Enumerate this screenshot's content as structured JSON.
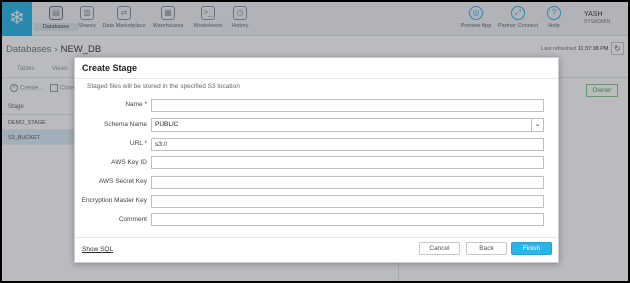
{
  "nav": {
    "logo_icon": "snowflake-icon",
    "items": [
      {
        "label": "Databases",
        "icon": "database-icon",
        "glyph": "▤"
      },
      {
        "label": "Shares",
        "icon": "share-icon",
        "glyph": "▥"
      },
      {
        "label": "Data Marketplace",
        "icon": "marketplace-icon",
        "glyph": "⇄"
      },
      {
        "label": "Warehouses",
        "icon": "warehouse-icon",
        "glyph": "▦"
      },
      {
        "label": "Worksheets",
        "icon": "worksheet-icon",
        "glyph": ">_"
      },
      {
        "label": "History",
        "icon": "history-icon",
        "glyph": "◷"
      }
    ],
    "right_items": [
      {
        "label": "Preview App",
        "icon": "preview-icon",
        "glyph": "◎"
      },
      {
        "label": "Partner Connect",
        "icon": "partner-connect-icon",
        "glyph": "⤢"
      },
      {
        "label": "Help",
        "icon": "help-icon",
        "glyph": "?"
      }
    ],
    "user": {
      "name": "YASH",
      "role": "SYSADMIN"
    }
  },
  "header": {
    "breadcrumb_root": "Databases",
    "breadcrumb_sep": "›",
    "breadcrumb_current": "NEW_DB",
    "refresh_label": "Last refreshed",
    "refresh_time": "11:37:38 PM"
  },
  "subtabs": [
    "Tables",
    "Views"
  ],
  "toolbar": {
    "create": "Create...",
    "clone": "Clone"
  },
  "grid": {
    "header": "Stage",
    "rows": [
      "DEMO_STAGE",
      "S3_BUCKET"
    ]
  },
  "owner_button": "Owner",
  "modal": {
    "title": "Create Stage",
    "description": "Staged files will be stored in the specified S3 location",
    "fields": {
      "name": {
        "label": "Name *",
        "value": ""
      },
      "schema": {
        "label": "Schema Name",
        "value": "PUBLIC"
      },
      "url": {
        "label": "URL *",
        "value": "s3://"
      },
      "aws_key_id": {
        "label": "AWS Key ID",
        "value": ""
      },
      "aws_secret_key": {
        "label": "AWS Secret Key",
        "value": ""
      },
      "encryption_key": {
        "label": "Encryption Master Key",
        "value": ""
      },
      "comment": {
        "label": "Comment",
        "value": ""
      }
    },
    "show_sql": "Show SQL",
    "cancel": "Cancel",
    "back": "Back",
    "finish": "Finish"
  },
  "colors": {
    "accent": "#29b5e8",
    "owner_green": "#4aa24e"
  }
}
